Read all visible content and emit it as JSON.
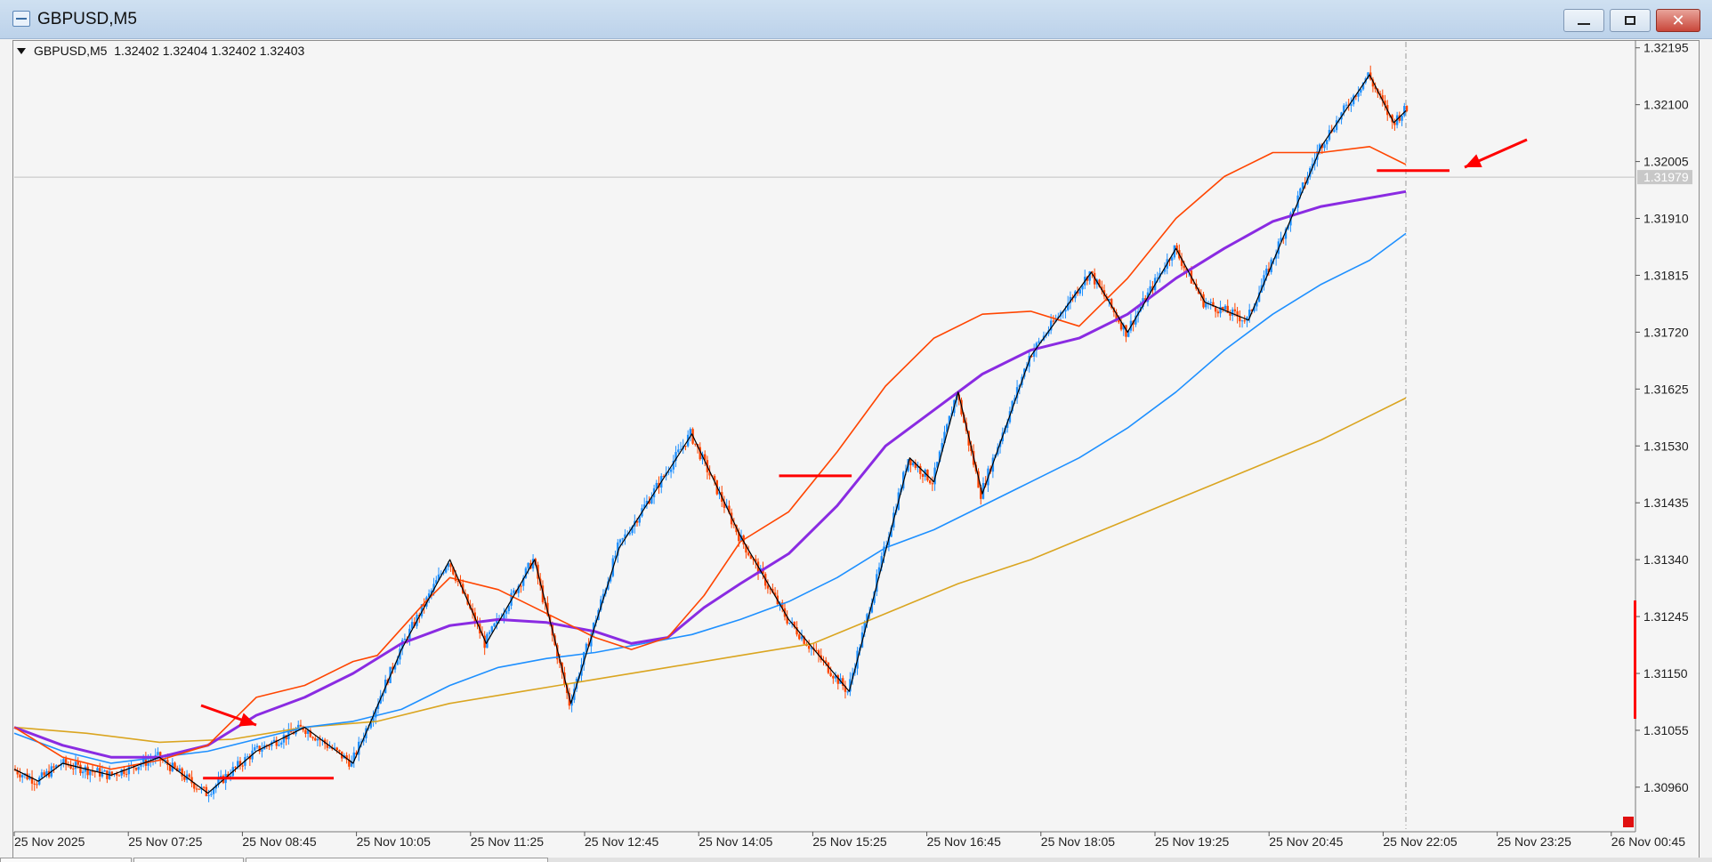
{
  "window": {
    "title": "GBPUSD,M5",
    "minimize_icon": "minimize-icon",
    "maximize_icon": "restore-icon",
    "close_icon": "close-icon"
  },
  "chart_info": {
    "symbol_tf": "GBPUSD,M5",
    "ohlc": "1.32402 1.32404 1.32402 1.32403"
  },
  "chart_data": {
    "type": "candlestick",
    "symbol": "GBPUSD",
    "timeframe": "M5",
    "ylim": [
      1.3089,
      1.32205
    ],
    "price_ticks": [
      "1.32195",
      "1.32100",
      "1.32005",
      "1.31910",
      "1.31815",
      "1.31720",
      "1.31625",
      "1.31530",
      "1.31435",
      "1.31340",
      "1.31245",
      "1.31150",
      "1.31055",
      "1.30960"
    ],
    "current_price": "1.31979",
    "time_ticks": [
      "25 Nov 2025",
      "25 Nov 07:25",
      "25 Nov 08:45",
      "25 Nov 10:05",
      "25 Nov 11:25",
      "25 Nov 12:45",
      "25 Nov 14:05",
      "25 Nov 15:25",
      "25 Nov 16:45",
      "25 Nov 18:05",
      "25 Nov 19:25",
      "25 Nov 20:45",
      "25 Nov 22:05",
      "25 Nov 23:25",
      "26 Nov 00:45"
    ],
    "colors": {
      "bull": "#1e90ff",
      "bear": "#ff4500",
      "ma_fast": "#ff4500",
      "ma_mid": "#8a2be2",
      "ma_slow": "#1e90ff",
      "ma_long": "#daa520",
      "zigzag": "#000000",
      "annotation": "#ff0000",
      "grid_line": "#c0c0c0"
    },
    "ma_fast": [
      [
        0,
        1.3106
      ],
      [
        20,
        1.3101
      ],
      [
        40,
        1.3099
      ],
      [
        60,
        1.31005
      ],
      [
        80,
        1.3103
      ],
      [
        100,
        1.3111
      ],
      [
        120,
        1.3113
      ],
      [
        140,
        1.3117
      ],
      [
        150,
        1.3118
      ],
      [
        170,
        1.3127
      ],
      [
        180,
        1.3131
      ],
      [
        200,
        1.3129
      ],
      [
        220,
        1.3125
      ],
      [
        240,
        1.3121
      ],
      [
        255,
        1.3119
      ],
      [
        270,
        1.3121
      ],
      [
        285,
        1.3128
      ],
      [
        300,
        1.3137
      ],
      [
        320,
        1.3142
      ],
      [
        340,
        1.3152
      ],
      [
        360,
        1.3163
      ],
      [
        380,
        1.3171
      ],
      [
        400,
        1.3175
      ],
      [
        420,
        1.31755
      ],
      [
        440,
        1.3173
      ],
      [
        460,
        1.3181
      ],
      [
        480,
        1.3191
      ],
      [
        500,
        1.3198
      ],
      [
        520,
        1.3202
      ],
      [
        540,
        1.3202
      ],
      [
        560,
        1.3203
      ],
      [
        575,
        1.32
      ]
    ],
    "ma_mid": [
      [
        0,
        1.3106
      ],
      [
        20,
        1.3103
      ],
      [
        40,
        1.3101
      ],
      [
        60,
        1.3101
      ],
      [
        80,
        1.3103
      ],
      [
        100,
        1.3108
      ],
      [
        120,
        1.3111
      ],
      [
        140,
        1.3115
      ],
      [
        160,
        1.312
      ],
      [
        180,
        1.3123
      ],
      [
        200,
        1.3124
      ],
      [
        220,
        1.31235
      ],
      [
        240,
        1.3122
      ],
      [
        255,
        1.312
      ],
      [
        270,
        1.3121
      ],
      [
        285,
        1.3126
      ],
      [
        300,
        1.313
      ],
      [
        320,
        1.3135
      ],
      [
        340,
        1.3143
      ],
      [
        360,
        1.3153
      ],
      [
        380,
        1.3159
      ],
      [
        400,
        1.3165
      ],
      [
        420,
        1.3169
      ],
      [
        440,
        1.3171
      ],
      [
        460,
        1.3175
      ],
      [
        480,
        1.3181
      ],
      [
        500,
        1.3186
      ],
      [
        520,
        1.31905
      ],
      [
        540,
        1.3193
      ],
      [
        575,
        1.31955
      ]
    ],
    "ma_slow": [
      [
        0,
        1.3105
      ],
      [
        20,
        1.3102
      ],
      [
        40,
        1.31
      ],
      [
        60,
        1.3101
      ],
      [
        80,
        1.3102
      ],
      [
        100,
        1.3104
      ],
      [
        120,
        1.3106
      ],
      [
        140,
        1.3107
      ],
      [
        160,
        1.3109
      ],
      [
        180,
        1.3113
      ],
      [
        200,
        1.3116
      ],
      [
        220,
        1.31175
      ],
      [
        240,
        1.31185
      ],
      [
        260,
        1.312
      ],
      [
        280,
        1.31215
      ],
      [
        300,
        1.3124
      ],
      [
        320,
        1.3127
      ],
      [
        340,
        1.3131
      ],
      [
        360,
        1.3136
      ],
      [
        380,
        1.3139
      ],
      [
        400,
        1.3143
      ],
      [
        420,
        1.3147
      ],
      [
        440,
        1.3151
      ],
      [
        460,
        1.3156
      ],
      [
        480,
        1.3162
      ],
      [
        500,
        1.3169
      ],
      [
        520,
        1.3175
      ],
      [
        540,
        1.318
      ],
      [
        560,
        1.3184
      ],
      [
        575,
        1.31885
      ]
    ],
    "ma_long": [
      [
        0,
        1.3106
      ],
      [
        30,
        1.3105
      ],
      [
        60,
        1.31035
      ],
      [
        90,
        1.3104
      ],
      [
        120,
        1.3106
      ],
      [
        150,
        1.3107
      ],
      [
        180,
        1.311
      ],
      [
        210,
        1.3112
      ],
      [
        240,
        1.3114
      ],
      [
        270,
        1.3116
      ],
      [
        300,
        1.3118
      ],
      [
        330,
        1.312
      ],
      [
        360,
        1.3125
      ],
      [
        390,
        1.313
      ],
      [
        420,
        1.3134
      ],
      [
        450,
        1.3139
      ],
      [
        480,
        1.3144
      ],
      [
        510,
        1.3149
      ],
      [
        540,
        1.3154
      ],
      [
        575,
        1.3161
      ]
    ],
    "zigzag": [
      [
        0,
        1.3099
      ],
      [
        10,
        1.3097
      ],
      [
        20,
        1.31
      ],
      [
        40,
        1.3098
      ],
      [
        60,
        1.3101
      ],
      [
        80,
        1.3095
      ],
      [
        100,
        1.3102
      ],
      [
        120,
        1.3106
      ],
      [
        140,
        1.31
      ],
      [
        160,
        1.3119
      ],
      [
        180,
        1.3134
      ],
      [
        195,
        1.312
      ],
      [
        215,
        1.3134
      ],
      [
        230,
        1.311
      ],
      [
        250,
        1.3136
      ],
      [
        280,
        1.3155
      ],
      [
        300,
        1.3138
      ],
      [
        320,
        1.3124
      ],
      [
        345,
        1.3112
      ],
      [
        370,
        1.3151
      ],
      [
        380,
        1.3147
      ],
      [
        390,
        1.3162
      ],
      [
        400,
        1.3145
      ],
      [
        420,
        1.3168
      ],
      [
        445,
        1.3182
      ],
      [
        460,
        1.3172
      ],
      [
        480,
        1.3186
      ],
      [
        492,
        1.3177
      ],
      [
        510,
        1.3174
      ],
      [
        540,
        1.3203
      ],
      [
        560,
        1.3215
      ],
      [
        570,
        1.3207
      ],
      [
        575,
        1.3209
      ]
    ]
  },
  "annotations": {
    "arrows": 2,
    "horizontal_levels": 3
  }
}
